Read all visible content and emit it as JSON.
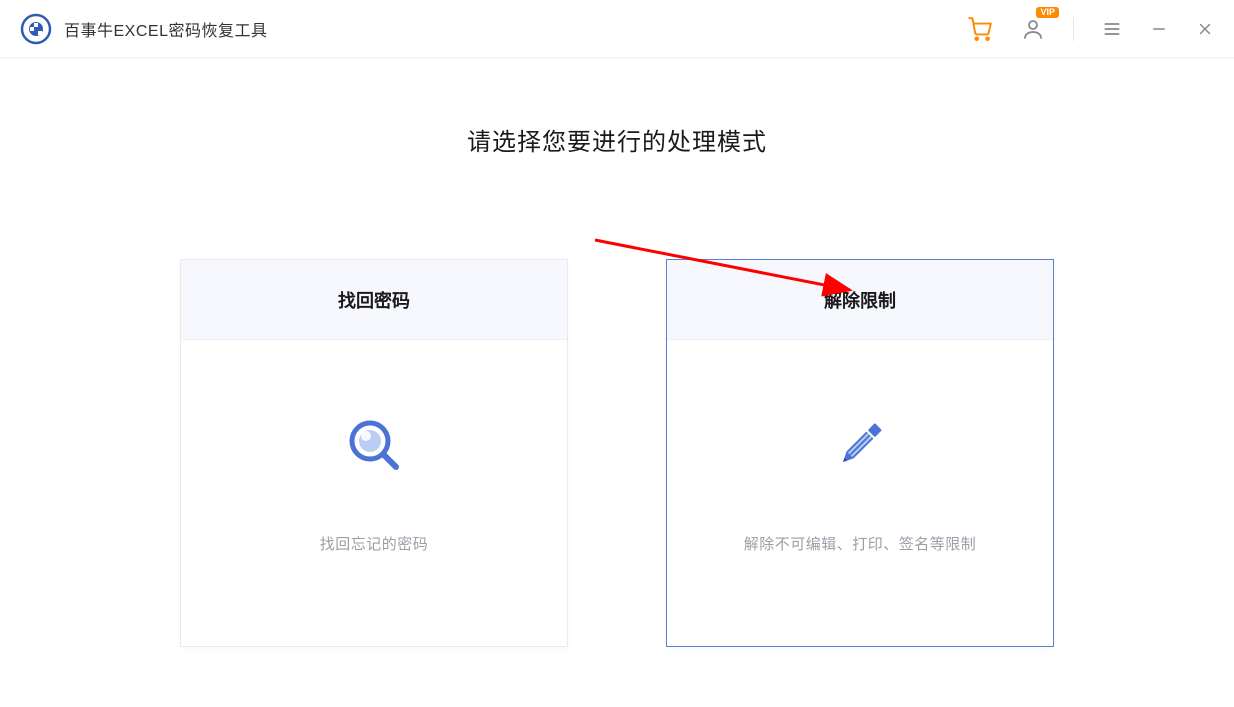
{
  "header": {
    "app_title": "百事牛EXCEL密码恢复工具",
    "vip_badge": "VIP"
  },
  "main": {
    "page_title": "请选择您要进行的处理模式",
    "cards": [
      {
        "title": "找回密码",
        "desc": "找回忘记的密码"
      },
      {
        "title": "解除限制",
        "desc": "解除不可编辑、打印、签名等限制"
      }
    ]
  }
}
